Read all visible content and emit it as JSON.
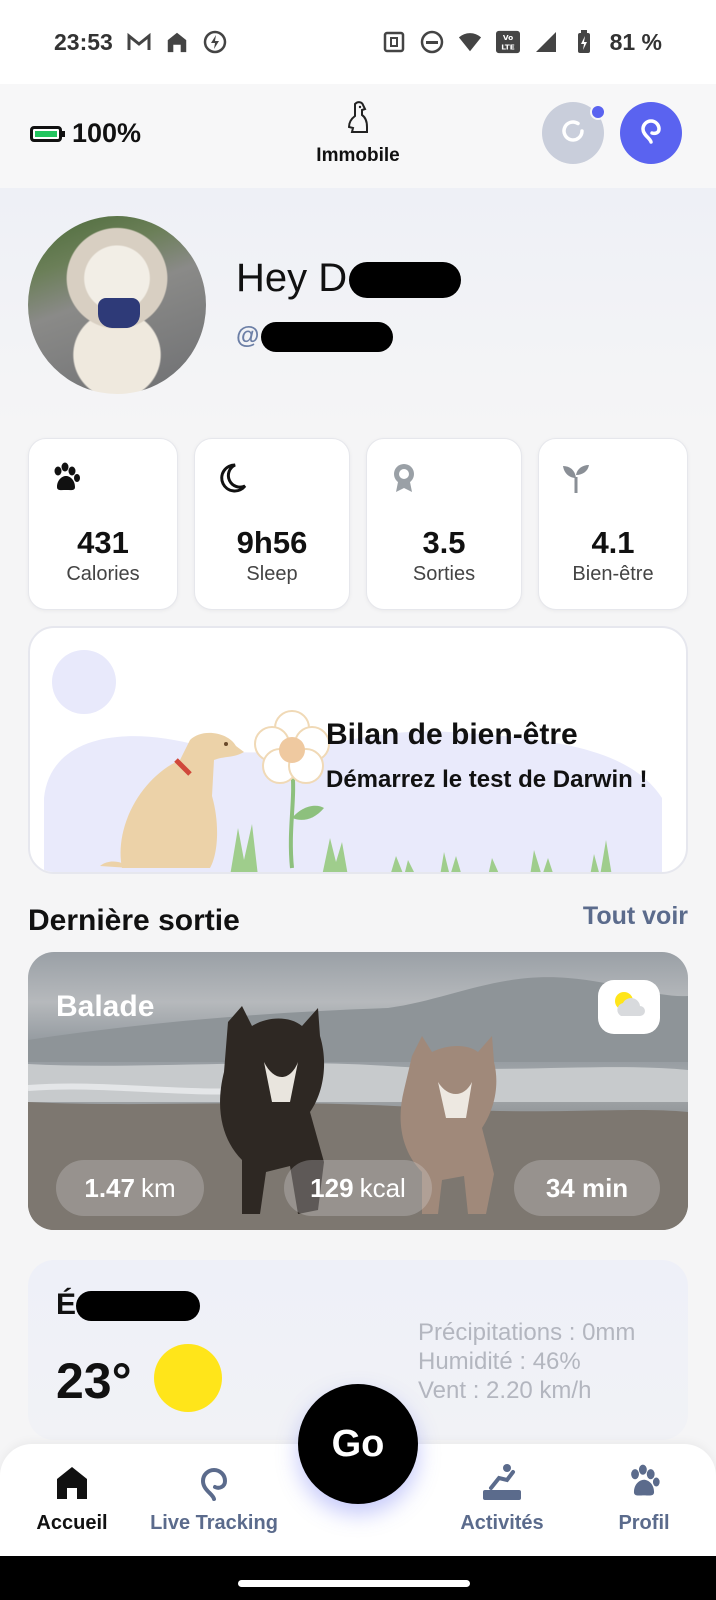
{
  "status_bar": {
    "time": "23:53",
    "battery": "81 %",
    "left_icons": [
      "gmail-icon",
      "home-icon",
      "bolt-icon"
    ],
    "right_icons": [
      "nfc-icon",
      "dnd-icon",
      "wifi-icon",
      "volte-icon",
      "signal-icon",
      "battery-charging-icon"
    ]
  },
  "header": {
    "battery_level": "100%",
    "dog_status": "Immobile"
  },
  "profile": {
    "greeting_prefix": "Hey D",
    "handle_prefix": "@"
  },
  "stats": [
    {
      "icon": "paw-icon",
      "value": "431",
      "label": "Calories"
    },
    {
      "icon": "moon-icon",
      "value": "9h56",
      "label": "Sleep"
    },
    {
      "icon": "medal-icon",
      "value": "3.5",
      "label": "Sorties"
    },
    {
      "icon": "sprout-icon",
      "value": "4.1",
      "label": "Bien-être"
    }
  ],
  "wellbeing_banner": {
    "title": "Bilan de bien-être",
    "subtitle": "Démarrez le test de Darwin !"
  },
  "last_walk": {
    "section_title": "Dernière sortie",
    "see_all": "Tout voir",
    "type": "Balade",
    "distance_value": "1.47",
    "distance_unit": "km",
    "calories_value": "129",
    "calories_unit": "kcal",
    "duration": "34 min"
  },
  "weather": {
    "city_prefix": "É",
    "temperature": "23°",
    "precipitation": "Précipitations : 0mm",
    "humidity": "Humidité : 46%",
    "wind": "Vent : 2.20 km/h"
  },
  "nav": {
    "home": "Accueil",
    "live": "Live Tracking",
    "go": "Go",
    "activities": "Activités",
    "profile": "Profil"
  },
  "colors": {
    "accent": "#5a63f0",
    "muted_text": "#5b6b8c",
    "sun": "#ffe51a"
  }
}
